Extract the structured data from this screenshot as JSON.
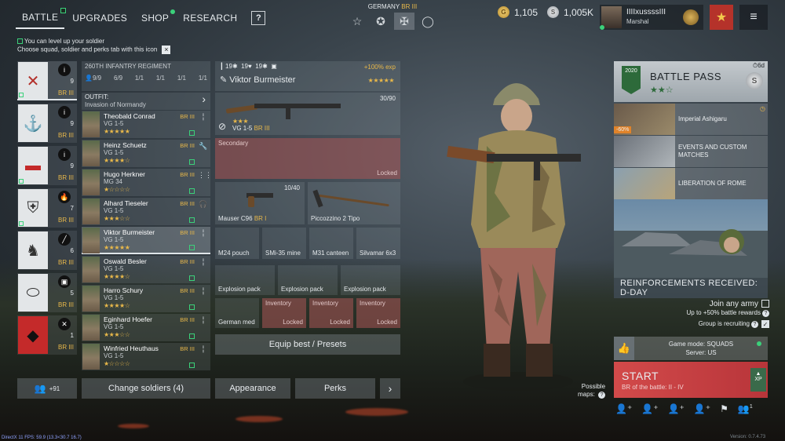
{
  "nav": {
    "tabs": [
      {
        "label": "BATTLE"
      },
      {
        "label": "UPGRADES"
      },
      {
        "label": "SHOP"
      },
      {
        "label": "RESEARCH"
      }
    ],
    "help": "?"
  },
  "nation": {
    "country": "GERMANY",
    "br": "BR III"
  },
  "currency": {
    "gold": "1,105",
    "silver": "1,005K"
  },
  "profile": {
    "name": "IIIIxussssIII",
    "rank": "Marshal"
  },
  "notice": {
    "line1": "You can level up your soldier",
    "line2": "Choose squad, soldier and perks tab with this icon",
    "close": "×"
  },
  "squads": [
    {
      "count": "9",
      "br": "BR III"
    },
    {
      "count": "9",
      "br": "BR III"
    },
    {
      "count": "9",
      "br": "BR III"
    },
    {
      "count": "7",
      "br": "BR III"
    },
    {
      "count": "6",
      "br": "BR III"
    },
    {
      "count": "5",
      "br": "BR III"
    },
    {
      "count": "1",
      "br": "BR III"
    }
  ],
  "regiment": {
    "name": "260TH INFANTRY REGIMENT",
    "size": "9/9",
    "s1": "6/9",
    "s2": "1/1",
    "s3": "1/1",
    "s4": "1/1",
    "s5": "1/1"
  },
  "outfit": {
    "label": "OUTFIT:",
    "value": "Invasion of Normandy"
  },
  "soldiers": [
    {
      "name": "Theobald Conrad",
      "cls": "VG 1-5",
      "br": "BR III",
      "stars": "★★★★★"
    },
    {
      "name": "Heinz Schuetz",
      "cls": "VG 1-5",
      "br": "BR III",
      "stars": "★★★★☆"
    },
    {
      "name": "Hugo Herkner",
      "cls": "MG 34",
      "br": "BR III",
      "stars": "★☆☆☆☆"
    },
    {
      "name": "Alhard Tieseler",
      "cls": "VG 1-5",
      "br": "BR III",
      "stars": "★★★☆☆"
    },
    {
      "name": "Viktor Burmeister",
      "cls": "VG 1-5",
      "br": "BR III",
      "stars": "★★★★★"
    },
    {
      "name": "Oswald Besler",
      "cls": "VG 1-5",
      "br": "BR III",
      "stars": "★★★★☆"
    },
    {
      "name": "Harro Schury",
      "cls": "VG 1-5",
      "br": "BR III",
      "stars": "★★★★☆"
    },
    {
      "name": "Eginhard Hoefer",
      "cls": "VG 1-5",
      "br": "BR III",
      "stars": "★★★☆☆"
    },
    {
      "name": "Winfried Heuthaus",
      "cls": "VG 1-5",
      "br": "BR III",
      "stars": "★☆☆☆☆"
    }
  ],
  "soldier_header": {
    "stat1": "19",
    "stat2": "19",
    "stat3": "19",
    "exp": "+100% exp",
    "name": "Viktor Burmeister",
    "stars": "★★★★★"
  },
  "slots": {
    "primary": {
      "name": "VG 1-5",
      "br": "BR III",
      "ammo": "30/90",
      "stars": "★★★"
    },
    "secondary": {
      "label": "Secondary",
      "lock": "Locked"
    },
    "pistol": {
      "name": "Mauser C96",
      "br": "BR I",
      "ammo": "10/40"
    },
    "melee": {
      "name": "Piccozzino 2 Tipo"
    },
    "items": [
      "M24 pouch",
      "SMi-35 mine",
      "M31 canteen",
      "Silvamar 6x3"
    ],
    "packs": [
      "Explosion pack",
      "Explosion pack",
      "Explosion pack"
    ],
    "medic": "German med",
    "inventory": [
      {
        "label": "Inventory",
        "lock": "Locked"
      },
      {
        "label": "Inventory",
        "lock": "Locked"
      },
      {
        "label": "Inventory",
        "lock": "Locked"
      }
    ]
  },
  "equip_btn": "Equip best / Presets",
  "bottom": {
    "count": "+91",
    "change": "Change soldiers (4)",
    "appearance": "Appearance",
    "perks": "Perks",
    "next": "›"
  },
  "battlepass": {
    "title": "BATTLE PASS",
    "stars": "★★☆",
    "days": "6d",
    "logo": "2020",
    "s": "S"
  },
  "events": [
    {
      "name": "Imperial Ashigaru",
      "tag": "-60%"
    },
    {
      "name": "EVENTS AND CUSTOM MATCHES"
    },
    {
      "name": "LIBERATION OF ROME"
    }
  ],
  "reinforcements": "REINFORCEMENTS RECEIVED: D-DAY",
  "join": {
    "label": "Join any army",
    "sub": "Up to +50% battle rewards",
    "recruit": "Group is recruiting"
  },
  "mode": {
    "line1": "Game mode: SQUADS",
    "line2": "Server: US"
  },
  "start": {
    "label": "START",
    "sub": "BR of the battle: II - IV",
    "xp": "XP"
  },
  "maps": {
    "label1": "Possible",
    "label2": "maps:"
  },
  "party_count": "1",
  "fps": "DirectX 11 FPS: 59.9 (13.3<30.7 16.7)",
  "version": "Version: 0.7.4.73"
}
